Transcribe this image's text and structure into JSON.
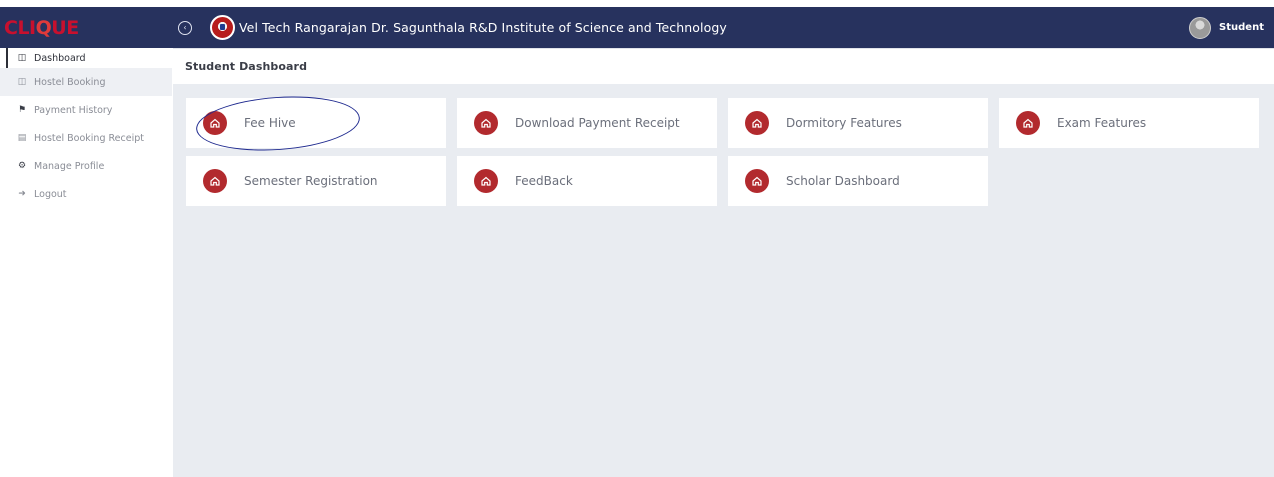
{
  "header": {
    "logo_text": "CLI",
    "logo_glyph": "Q",
    "logo_tail": "UE",
    "institution_name": "Vel Tech Rangarajan Dr. Sagunthala R&D Institute of Science and Technology",
    "user_name": "Student"
  },
  "sidebar": {
    "items": [
      {
        "label": "Dashboard",
        "icon": "dashboard-icon"
      },
      {
        "label": "Hostel Booking",
        "icon": "dashboard-icon"
      },
      {
        "label": "Payment History",
        "icon": "paypal-icon"
      },
      {
        "label": "Hostel Booking Receipt",
        "icon": "credit-card-icon"
      },
      {
        "label": "Manage Profile",
        "icon": "gears-icon"
      },
      {
        "label": "Logout",
        "icon": "sign-out-icon"
      }
    ]
  },
  "main": {
    "page_title": "Student Dashboard",
    "cards": [
      {
        "label": "Fee Hive",
        "icon": "home-icon"
      },
      {
        "label": "Download Payment Receipt",
        "icon": "home-icon"
      },
      {
        "label": "Dormitory Features",
        "icon": "home-icon"
      },
      {
        "label": "Exam Features",
        "icon": "home-icon"
      },
      {
        "label": "Semester Registration",
        "icon": "home-icon"
      },
      {
        "label": "FeedBack",
        "icon": "home-icon"
      },
      {
        "label": "Scholar Dashboard",
        "icon": "home-icon"
      }
    ]
  },
  "colors": {
    "topbar": "#27325e",
    "card_icon": "#b22a2e",
    "background": "#e9ecf1",
    "annotation": "#1f2a8f"
  }
}
